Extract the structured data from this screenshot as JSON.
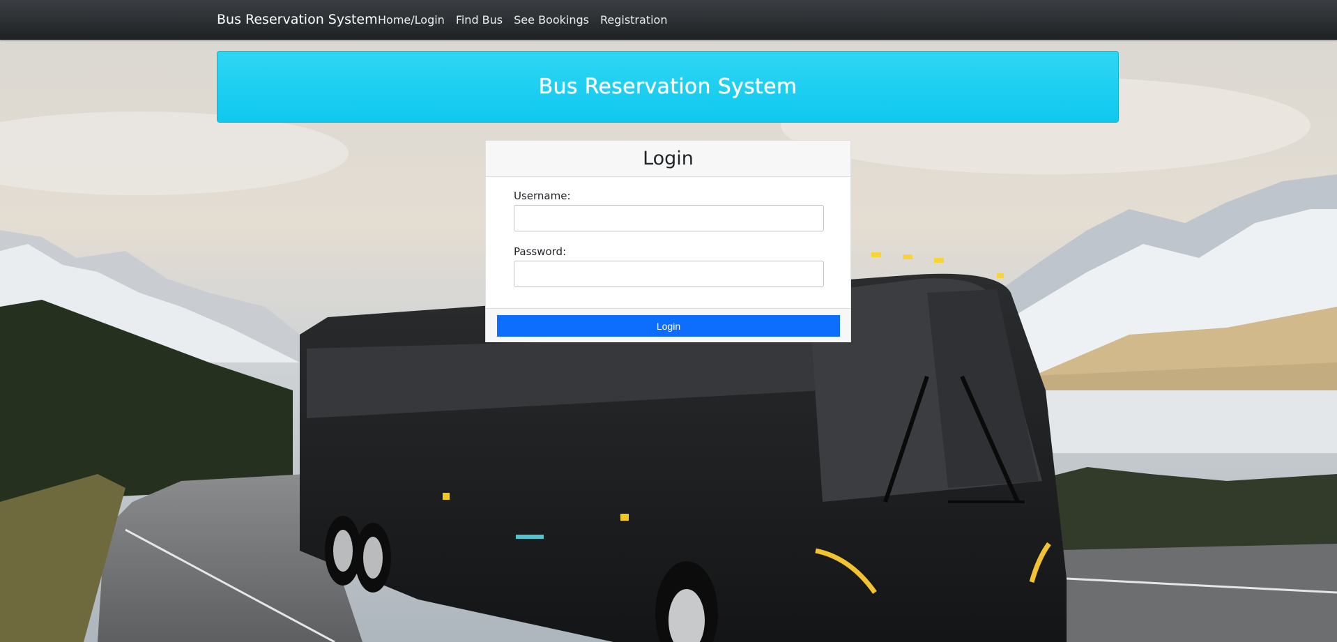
{
  "navbar": {
    "brand": "Bus Reservation System",
    "links": [
      "Home/Login",
      "Find Bus",
      "See Bookings",
      "Registration"
    ]
  },
  "banner": {
    "title": "Bus Reservation System"
  },
  "login": {
    "title": "Login",
    "username_label": "Username:",
    "username_value": "",
    "password_label": "Password:",
    "password_value": "",
    "submit_label": "Login"
  },
  "colors": {
    "navbar": "#24272a",
    "banner": "#1ccdf1",
    "primary_button": "#0d6efd"
  },
  "background": {
    "image_subject": "coach-bus-on-mountain-road"
  }
}
